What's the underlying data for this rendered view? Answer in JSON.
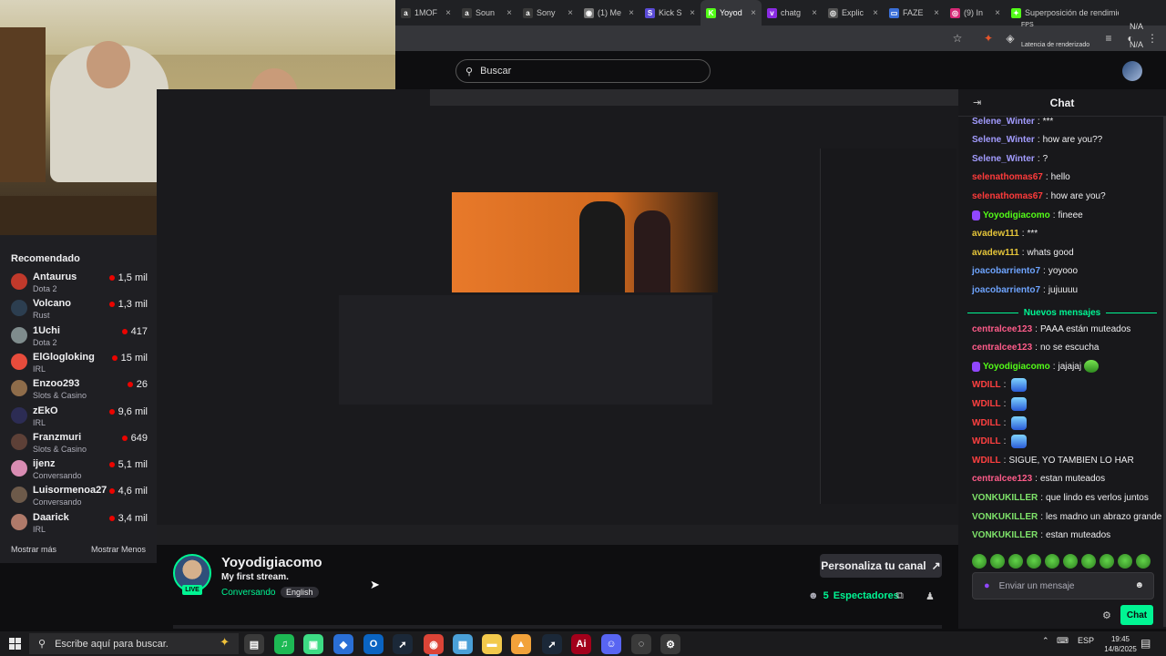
{
  "browser": {
    "tabs": [
      {
        "label": "1MOF",
        "color": "#3a3a3a",
        "glyph": "a"
      },
      {
        "label": "Soun",
        "color": "#3a3a3a",
        "glyph": "a"
      },
      {
        "label": "Sony",
        "color": "#3a3a3a",
        "glyph": "a"
      },
      {
        "label": "(1) Me",
        "color": "#777777",
        "glyph": "◉"
      },
      {
        "label": "Kick S",
        "color": "#5a4bd6",
        "glyph": "S"
      },
      {
        "label": "Yoyod",
        "color": "#53fc18",
        "glyph": "K"
      },
      {
        "label": "chatg",
        "color": "#8a2be2",
        "glyph": "v"
      },
      {
        "label": "Explic",
        "color": "#555555",
        "glyph": "◎"
      },
      {
        "label": "FAZE",
        "color": "#3a6fd8",
        "glyph": "▭"
      },
      {
        "label": "(9) In",
        "color": "#d62976",
        "glyph": "◎"
      },
      {
        "label": "Superposición de rendimiento (Alt+R)",
        "color": "#53fc18",
        "glyph": "✦"
      }
    ],
    "active_tab_index": 5
  },
  "perf_overlay": {
    "fps_label": "FPS",
    "fps_value": "N/A",
    "latency_label": "Latencia de renderizado",
    "latency_value": "N/A"
  },
  "header": {
    "search_placeholder": "Buscar"
  },
  "sidebar": {
    "title": "Recomendado",
    "items": [
      {
        "name": "Antaurus",
        "category": "Dota 2",
        "viewers": "1,5 mil",
        "color": "#c0392b"
      },
      {
        "name": "Volcano",
        "category": "Rust",
        "viewers": "1,3 mil",
        "color": "#2c3e50"
      },
      {
        "name": "1Uchi",
        "category": "Dota 2",
        "viewers": "417",
        "color": "#7f8c8d"
      },
      {
        "name": "ElGlogloking",
        "category": "IRL",
        "viewers": "15 mil",
        "color": "#e74c3c"
      },
      {
        "name": "Enzoo293",
        "category": "Slots & Casino",
        "viewers": "26",
        "color": "#8e6c4a"
      },
      {
        "name": "zEkO",
        "category": "IRL",
        "viewers": "9,6 mil",
        "color": "#2c2c54"
      },
      {
        "name": "Franzmuri",
        "category": "Slots & Casino",
        "viewers": "649",
        "color": "#5d4037"
      },
      {
        "name": "ijenz",
        "category": "Conversando",
        "viewers": "5,1 mil",
        "color": "#d98cb3"
      },
      {
        "name": "Luisormenoa27",
        "category": "Conversando",
        "viewers": "4,6 mil",
        "color": "#6d5a4a"
      },
      {
        "name": "Daarick",
        "category": "IRL",
        "viewers": "3,4 mil",
        "color": "#b07a6a"
      }
    ],
    "show_more": "Mostrar más",
    "show_less": "Mostrar Menos"
  },
  "channel": {
    "name": "Yoyodigiacomo",
    "title": "My first stream.",
    "category": "Conversando",
    "language": "English",
    "live_label": "LIVE",
    "customize_button": "Personaliza tu canal",
    "viewers_count": "5",
    "viewers_label": "Espectadores"
  },
  "chat": {
    "title": "Chat",
    "new_messages_label": "Nuevos mensajes",
    "messages_before": [
      {
        "user": "Selene_Winter",
        "color": "#a29bfe",
        "text": "***"
      },
      {
        "user": "Selene_Winter",
        "color": "#a29bfe",
        "text": "how are you??"
      },
      {
        "user": "Selene_Winter",
        "color": "#a29bfe",
        "text": "?"
      },
      {
        "user": "selenathomas67",
        "color": "#ff3b3b",
        "text": "hello"
      },
      {
        "user": "selenathomas67",
        "color": "#ff3b3b",
        "text": "how are you?"
      },
      {
        "user": "Yoyodigiacomo",
        "color": "#53fc18",
        "text": "fineee",
        "badge": true
      },
      {
        "user": "avadew111",
        "color": "#e5c53a",
        "text": "***"
      },
      {
        "user": "avadew111",
        "color": "#e5c53a",
        "text": "whats good"
      },
      {
        "user": "joacobarriento7",
        "color": "#6ea4ff",
        "text": "yoyooo"
      },
      {
        "user": "joacobarriento7",
        "color": "#6ea4ff",
        "text": "jujuuuu"
      }
    ],
    "messages_after": [
      {
        "user": "centralcee123",
        "color": "#ff5c8a",
        "text": "PAAA están muteados"
      },
      {
        "user": "centralcee123",
        "color": "#ff5c8a",
        "text": "no se escucha"
      },
      {
        "user": "Yoyodigiacomo",
        "color": "#53fc18",
        "text": "jajajaj",
        "badge": true,
        "emotes": 1,
        "emote_type": "green"
      },
      {
        "user": "WDILL",
        "color": "#ff4040",
        "text": "",
        "emotes": 1
      },
      {
        "user": "WDILL",
        "color": "#ff4040",
        "text": "",
        "emotes": 1
      },
      {
        "user": "WDILL",
        "color": "#ff4040",
        "text": "",
        "emotes": 1
      },
      {
        "user": "WDILL",
        "color": "#ff4040",
        "text": "",
        "emotes": 1
      },
      {
        "user": "WDILL",
        "color": "#ff4040",
        "text": "SIGUE, YO TAMBIEN LO HAR"
      },
      {
        "user": "centralcee123",
        "color": "#ff5c8a",
        "text": "estan muteados"
      },
      {
        "user": "VONKUKILLER",
        "color": "#7ee36a",
        "text": "que lindo es verlos juntos"
      },
      {
        "user": "VONKUKILLER",
        "color": "#7ee36a",
        "text": "les madno un abrazo grande"
      },
      {
        "user": "VONKUKILLER",
        "color": "#7ee36a",
        "text": "estan muteados"
      }
    ],
    "input_placeholder": "Enviar un mensaje",
    "send_button": "Chat"
  },
  "taskbar": {
    "search_placeholder": "Escribe aquí para buscar.",
    "apps": [
      {
        "name": "task-view",
        "color": "#3a3a3a",
        "glyph": "▤"
      },
      {
        "name": "spotify",
        "color": "#1db954",
        "glyph": "♫"
      },
      {
        "name": "android-app",
        "color": "#3ddc84",
        "glyph": "▣"
      },
      {
        "name": "copilot-app",
        "color": "#2a6fd6",
        "glyph": "◆"
      },
      {
        "name": "outlook",
        "color": "#0a64c2",
        "glyph": "O"
      },
      {
        "name": "steam-a",
        "color": "#1b2838",
        "glyph": "➚"
      },
      {
        "name": "chrome",
        "color": "#db4437",
        "glyph": "◉"
      },
      {
        "name": "files-app",
        "color": "#4aa0d8",
        "glyph": "▦"
      },
      {
        "name": "file-explorer",
        "color": "#f2c94c",
        "glyph": "▬"
      },
      {
        "name": "vpn-shield",
        "color": "#f2a23a",
        "glyph": "▲"
      },
      {
        "name": "steam-b",
        "color": "#1b2838",
        "glyph": "➚"
      },
      {
        "name": "adobe",
        "color": "#a3001b",
        "glyph": "Ai"
      },
      {
        "name": "discord",
        "color": "#5865f2",
        "glyph": "☺"
      },
      {
        "name": "obs",
        "color": "#3a3a3a",
        "glyph": "◌"
      },
      {
        "name": "settings",
        "color": "#3a3a3a",
        "glyph": "⚙"
      }
    ],
    "language": "ESP",
    "time": "19:45",
    "date": "14/8/2025"
  }
}
